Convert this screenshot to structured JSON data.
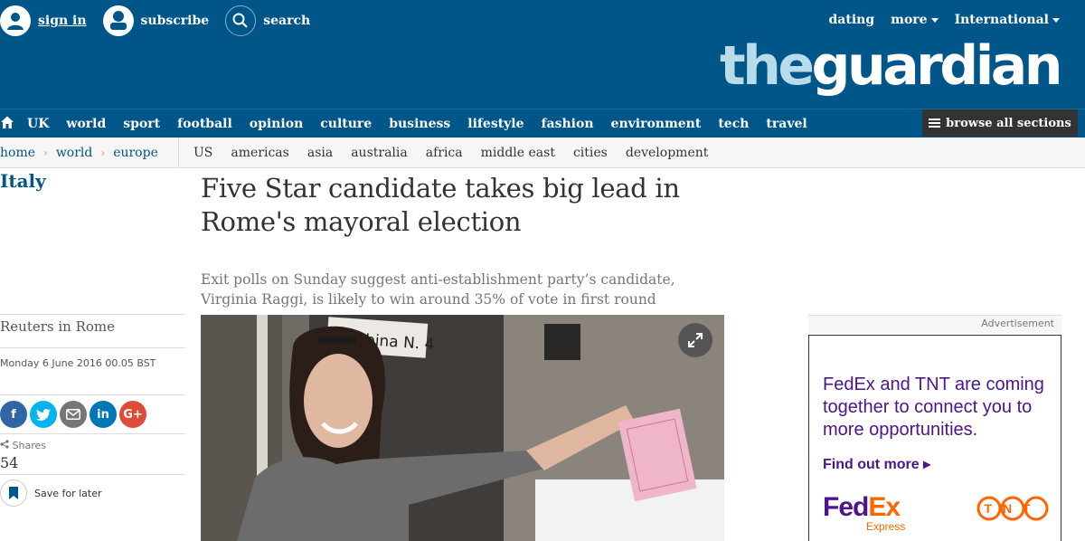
{
  "header": {
    "sign_in": "sign in",
    "subscribe": "subscribe",
    "search": "search",
    "dating": "dating",
    "more": "more",
    "edition": "International",
    "logo_the": "the",
    "logo_guardian": "guardian"
  },
  "nav": {
    "items": [
      "UK",
      "world",
      "sport",
      "football",
      "opinion",
      "culture",
      "business",
      "lifestyle",
      "fashion",
      "environment",
      "tech",
      "travel"
    ],
    "browse": "browse all sections"
  },
  "breadcrumb": [
    "home",
    "world",
    "europe"
  ],
  "subnav": [
    "US",
    "americas",
    "asia",
    "australia",
    "africa",
    "middle east",
    "cities",
    "development"
  ],
  "article": {
    "kicker": "Italy",
    "headline": "Five Star candidate takes big lead in Rome's mayoral election",
    "standfirst": "Exit polls on Sunday suggest anti-establishment party’s candidate, Virginia Raggi, is likely to win around 35% of vote in first round",
    "byline": "Reuters in Rome",
    "date": "Monday 6 June 2016 00.05 BST",
    "shares_label": "Shares",
    "shares_count": "54",
    "save_label": "Save for later",
    "photo_sign": "Cabina N. 4"
  },
  "share_icons": [
    "facebook-icon",
    "twitter-icon",
    "email-icon",
    "linkedin-icon",
    "google-plus-icon"
  ],
  "advert": {
    "label": "Advertisement",
    "text": "FedEx and TNT are coming together to connect you to more opportunities.",
    "cta": "Find out more ▸",
    "fedex_fed": "Fed",
    "fedex_ex": "Ex",
    "fedex_sub": "Express",
    "tnt": "TNT"
  },
  "colors": {
    "brand_blue": "#005689",
    "logo_light": "#b8dcea",
    "fedex_purple": "#4d148c",
    "orange": "#ff6600"
  }
}
